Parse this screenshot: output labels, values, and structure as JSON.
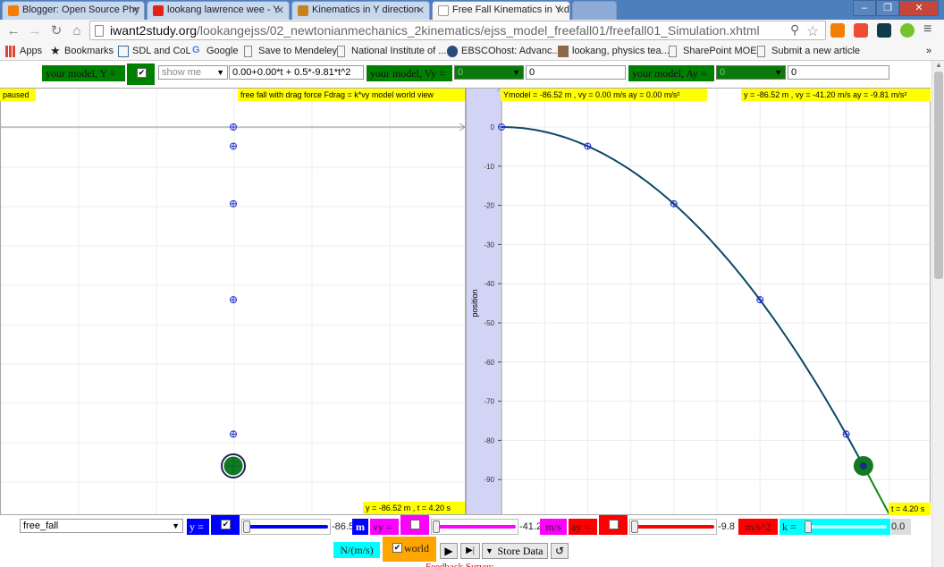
{
  "browser": {
    "tabs": [
      {
        "title": "Blogger: Open Source Phy",
        "fav_color": "#f57d00"
      },
      {
        "title": "lookang lawrence wee - Y",
        "fav_color": "#e62117"
      },
      {
        "title": "Kinematics in Y direction",
        "fav_color": "#c9811b"
      },
      {
        "title": "Free Fall Kinematics in Y d",
        "fav_color": "#ffffff"
      }
    ],
    "url_host": "iwant2study.org",
    "url_path": "/lookangejss/02_newtonianmechanics_2kinematics/ejss_model_freefall01/freefall01_Simulation.xhtml",
    "bookmarks": [
      {
        "label": "Apps",
        "icon": "apps-grid-icon"
      },
      {
        "label": "Bookmarks",
        "icon": "star-icon"
      },
      {
        "label": "SDL and CoL",
        "icon": "calendar-icon"
      },
      {
        "label": "Google",
        "icon": "google-icon"
      },
      {
        "label": "Save to Mendeley",
        "icon": "page-icon"
      },
      {
        "label": "National Institute of ...",
        "icon": "page-icon"
      },
      {
        "label": "EBSCOhost: Advanc...",
        "icon": "ebsco-icon"
      },
      {
        "label": "lookang, physics tea...",
        "icon": "photo-icon"
      },
      {
        "label": "SharePoint MOE",
        "icon": "page-icon"
      },
      {
        "label": "Submit a new article",
        "icon": "page-icon"
      }
    ],
    "window_controls": {
      "minimize": "–",
      "maximize": "❐",
      "close": "✕"
    }
  },
  "top_controls": {
    "model_y_label": "your model, Y =",
    "model_y_checked": "✔",
    "show_select": "show me",
    "model_y_expr": "0.00+0.00*t + 0.5*-9.81*t^2",
    "model_vy_label": "your model, Vy =",
    "model_vy_select": "0",
    "model_vy_value": "0",
    "model_ay_label": "your model, Ay =",
    "model_ay_select": "0",
    "model_ay_value": "0"
  },
  "left_panel": {
    "status": "paused",
    "title": "free fall with drag force Fdrag = k*vy model world view",
    "readout": "y = -86.52 m , t = 4.20 s"
  },
  "right_panel": {
    "readout_model": "Ymodel = -86.52 m , vy = 0.00 m/s ay = 0.00 m/s²",
    "readout_sim": "y = -86.52 m , vy = -41.20 m/s ay = -9.81 m/s²",
    "time_readout": "t = 4.20 s",
    "ylabel": "position"
  },
  "chart_data": {
    "type": "scatter",
    "title": "",
    "xlabel": "",
    "ylabel": "position",
    "ylim": [
      -100,
      5
    ],
    "xlim": [
      0,
      4.4
    ],
    "yticks": [
      0,
      -10,
      -20,
      -30,
      -40,
      -50,
      -60,
      -70,
      -80,
      -90,
      -100
    ],
    "x": [
      0,
      1,
      2,
      3,
      4
    ],
    "series": [
      {
        "values": [
          0,
          -4.9,
          -19.6,
          -44.1,
          -78.4
        ]
      }
    ],
    "current_point": {
      "t": 4.2,
      "y": -86.52
    }
  },
  "bottom_controls": {
    "model_select": "free_fall",
    "y_label": "y =",
    "y_checked": "✔",
    "y_value": "-86.5",
    "y_unit": "m",
    "vy_label": "vy =",
    "vy_checked": "",
    "vy_value": "-41.2",
    "vy_unit": "m/s",
    "ay_label": "ay =",
    "ay_checked": "",
    "ay_value": "-9.8",
    "ay_unit": "m/s^2",
    "k_label": "k =",
    "k_value": "0.0",
    "k_unit": "N/(m/s)",
    "world_label": "world",
    "world_checked": "✔",
    "store_label": "Store Data",
    "footer_text": "Feedback Survey"
  },
  "colors": {
    "green": "#008000",
    "blue": "#0000ff",
    "magenta": "#ff00ff",
    "red": "#ff0000",
    "cyan": "#00ffff",
    "orange": "#ffa500",
    "yellow": "#ffff00",
    "curve": "#0b4868"
  },
  "world_view_points_y": [
    0,
    -4.9,
    -19.6,
    -44.1,
    -78.4
  ],
  "ball_y": -86.52
}
